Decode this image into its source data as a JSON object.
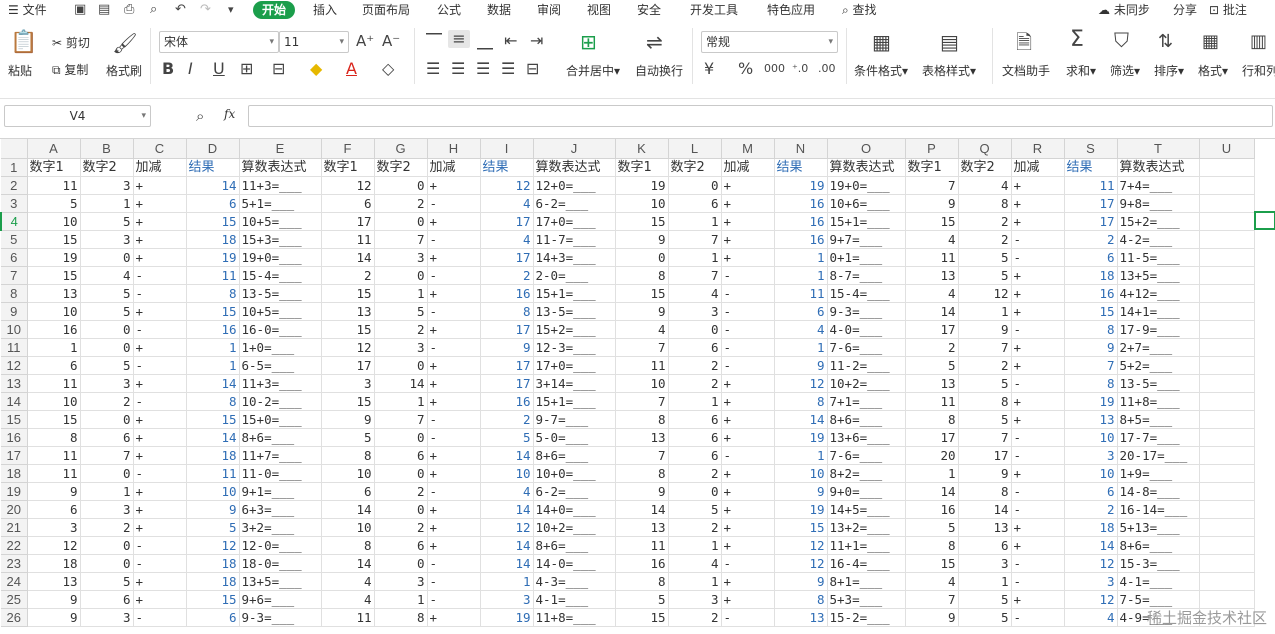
{
  "menu": {
    "items": [
      "文件",
      "开始",
      "插入",
      "页面布局",
      "公式",
      "数据",
      "审阅",
      "视图",
      "安全",
      "开发工具",
      "特色应用",
      "查找"
    ],
    "active": "开始",
    "right": [
      "未同步",
      "分享",
      "批注"
    ]
  },
  "ribbon": {
    "paste": "粘贴",
    "cut": "剪切",
    "copy": "复制",
    "format_painter": "格式刷",
    "font_name": "宋体",
    "font_size": "11",
    "merge_center": "合并居中",
    "auto_wrap": "自动换行",
    "number_format": "常规",
    "conditional_format": "条件格式",
    "table_style": "表格样式",
    "doc_helper": "文档助手",
    "sum": "求和",
    "filter": "筛选",
    "sort": "排序",
    "format": "格式",
    "rows_cols": "行和列"
  },
  "formula_bar": {
    "cell_ref": "V4",
    "fx": "fx",
    "content": ""
  },
  "columns": [
    "A",
    "B",
    "C",
    "D",
    "E",
    "F",
    "G",
    "H",
    "I",
    "J",
    "K",
    "L",
    "M",
    "N",
    "O",
    "P",
    "Q",
    "R",
    "S",
    "T",
    "U"
  ],
  "header_row": [
    "数字1",
    "数字2",
    "加减",
    "结果",
    "算数表达式",
    "数字1",
    "数字2",
    "加减",
    "结果",
    "算数表达式",
    "数字1",
    "数字2",
    "加减",
    "结果",
    "算数表达式",
    "数字1",
    "数字2",
    "加减",
    "结果",
    "算数表达式",
    ""
  ],
  "rows": [
    [
      11,
      3,
      "+",
      14,
      "11+3=___",
      12,
      0,
      "+",
      12,
      "12+0=___",
      19,
      0,
      "+",
      19,
      "19+0=___",
      7,
      4,
      "+",
      11,
      "7+4=___"
    ],
    [
      5,
      1,
      "+",
      6,
      "5+1=___",
      6,
      2,
      "-",
      4,
      "6-2=___",
      10,
      6,
      "+",
      16,
      "10+6=___",
      9,
      8,
      "+",
      17,
      "9+8=___"
    ],
    [
      10,
      5,
      "+",
      15,
      "10+5=___",
      17,
      0,
      "+",
      17,
      "17+0=___",
      15,
      1,
      "+",
      16,
      "15+1=___",
      15,
      2,
      "+",
      17,
      "15+2=___"
    ],
    [
      15,
      3,
      "+",
      18,
      "15+3=___",
      11,
      7,
      "-",
      4,
      "11-7=___",
      9,
      7,
      "+",
      16,
      "9+7=___",
      4,
      2,
      "-",
      2,
      "4-2=___"
    ],
    [
      19,
      0,
      "+",
      19,
      "19+0=___",
      14,
      3,
      "+",
      17,
      "14+3=___",
      0,
      1,
      "+",
      1,
      "0+1=___",
      11,
      5,
      "-",
      6,
      "11-5=___"
    ],
    [
      15,
      4,
      "-",
      11,
      "15-4=___",
      2,
      0,
      "-",
      2,
      "2-0=___",
      8,
      7,
      "-",
      1,
      "8-7=___",
      13,
      5,
      "+",
      18,
      "13+5=___"
    ],
    [
      13,
      5,
      "-",
      8,
      "13-5=___",
      15,
      1,
      "+",
      16,
      "15+1=___",
      15,
      4,
      "-",
      11,
      "15-4=___",
      4,
      12,
      "+",
      16,
      "4+12=___"
    ],
    [
      10,
      5,
      "+",
      15,
      "10+5=___",
      13,
      5,
      "-",
      8,
      "13-5=___",
      9,
      3,
      "-",
      6,
      "9-3=___",
      14,
      1,
      "+",
      15,
      "14+1=___"
    ],
    [
      16,
      0,
      "-",
      16,
      "16-0=___",
      15,
      2,
      "+",
      17,
      "15+2=___",
      4,
      0,
      "-",
      4,
      "4-0=___",
      17,
      9,
      "-",
      8,
      "17-9=___"
    ],
    [
      1,
      0,
      "+",
      1,
      "1+0=___",
      12,
      3,
      "-",
      9,
      "12-3=___",
      7,
      6,
      "-",
      1,
      "7-6=___",
      2,
      7,
      "+",
      9,
      "2+7=___"
    ],
    [
      6,
      5,
      "-",
      1,
      "6-5=___",
      17,
      0,
      "+",
      17,
      "17+0=___",
      11,
      2,
      "-",
      9,
      "11-2=___",
      5,
      2,
      "+",
      7,
      "5+2=___"
    ],
    [
      11,
      3,
      "+",
      14,
      "11+3=___",
      3,
      14,
      "+",
      17,
      "3+14=___",
      10,
      2,
      "+",
      12,
      "10+2=___",
      13,
      5,
      "-",
      8,
      "13-5=___"
    ],
    [
      10,
      2,
      "-",
      8,
      "10-2=___",
      15,
      1,
      "+",
      16,
      "15+1=___",
      7,
      1,
      "+",
      8,
      "7+1=___",
      11,
      8,
      "+",
      19,
      "11+8=___"
    ],
    [
      15,
      0,
      "+",
      15,
      "15+0=___",
      9,
      7,
      "-",
      2,
      "9-7=___",
      8,
      6,
      "+",
      14,
      "8+6=___",
      8,
      5,
      "+",
      13,
      "8+5=___"
    ],
    [
      8,
      6,
      "+",
      14,
      "8+6=___",
      5,
      0,
      "-",
      5,
      "5-0=___",
      13,
      6,
      "+",
      19,
      "13+6=___",
      17,
      7,
      "-",
      10,
      "17-7=___"
    ],
    [
      11,
      7,
      "+",
      18,
      "11+7=___",
      8,
      6,
      "+",
      14,
      "8+6=___",
      7,
      6,
      "-",
      1,
      "7-6=___",
      20,
      17,
      "-",
      3,
      "20-17=___"
    ],
    [
      11,
      0,
      "-",
      11,
      "11-0=___",
      10,
      0,
      "+",
      10,
      "10+0=___",
      8,
      2,
      "+",
      10,
      "8+2=___",
      1,
      9,
      "+",
      10,
      "1+9=___"
    ],
    [
      9,
      1,
      "+",
      10,
      "9+1=___",
      6,
      2,
      "-",
      4,
      "6-2=___",
      9,
      0,
      "+",
      9,
      "9+0=___",
      14,
      8,
      "-",
      6,
      "14-8=___"
    ],
    [
      6,
      3,
      "+",
      9,
      "6+3=___",
      14,
      0,
      "+",
      14,
      "14+0=___",
      14,
      5,
      "+",
      19,
      "14+5=___",
      16,
      14,
      "-",
      2,
      "16-14=___"
    ],
    [
      3,
      2,
      "+",
      5,
      "3+2=___",
      10,
      2,
      "+",
      12,
      "10+2=___",
      13,
      2,
      "+",
      15,
      "13+2=___",
      5,
      13,
      "+",
      18,
      "5+13=___"
    ],
    [
      12,
      0,
      "-",
      12,
      "12-0=___",
      8,
      6,
      "+",
      14,
      "8+6=___",
      11,
      1,
      "+",
      12,
      "11+1=___",
      8,
      6,
      "+",
      14,
      "8+6=___"
    ],
    [
      18,
      0,
      "-",
      18,
      "18-0=___",
      14,
      0,
      "-",
      14,
      "14-0=___",
      16,
      4,
      "-",
      12,
      "16-4=___",
      15,
      3,
      "-",
      12,
      "15-3=___"
    ],
    [
      13,
      5,
      "+",
      18,
      "13+5=___",
      4,
      3,
      "-",
      1,
      "4-3=___",
      8,
      1,
      "+",
      9,
      "8+1=___",
      4,
      1,
      "-",
      3,
      "4-1=___"
    ],
    [
      9,
      6,
      "+",
      15,
      "9+6=___",
      4,
      1,
      "-",
      3,
      "4-1=___",
      5,
      3,
      "+",
      8,
      "5+3=___",
      7,
      5,
      "+",
      12,
      "7-5=___"
    ],
    [
      9,
      3,
      "-",
      6,
      "9-3=___",
      11,
      8,
      "+",
      19,
      "11+8=___",
      15,
      2,
      "-",
      13,
      "15-2=___",
      9,
      5,
      "-",
      4,
      "4-9=___"
    ]
  ],
  "watermark": "稀土掘金技术社区",
  "colors": {
    "accent": "#1b9e4b",
    "result_blue": "#2f6db5"
  }
}
